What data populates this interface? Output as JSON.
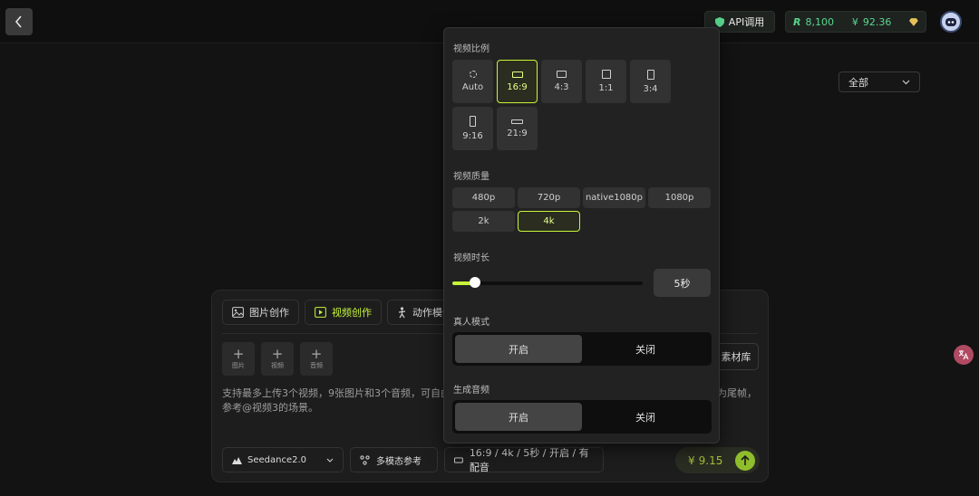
{
  "topbar": {
    "api_label": "API调用",
    "credits_value": "8,100",
    "balance_value": "92.36",
    "credit_symbol": "R",
    "currency_symbol": "¥"
  },
  "filter": {
    "selected": "全部"
  },
  "popover": {
    "ratio_title": "视频比例",
    "ratios": [
      {
        "label": "Auto",
        "selected": false
      },
      {
        "label": "16:9",
        "selected": true
      },
      {
        "label": "4:3",
        "selected": false
      },
      {
        "label": "1:1",
        "selected": false
      },
      {
        "label": "3:4",
        "selected": false
      },
      {
        "label": "9:16",
        "selected": false
      },
      {
        "label": "21:9",
        "selected": false
      }
    ],
    "quality_title": "视频质量",
    "qualities": [
      {
        "label": "480p",
        "selected": false
      },
      {
        "label": "720p",
        "selected": false
      },
      {
        "label": "native1080p",
        "selected": false
      },
      {
        "label": "1080p",
        "selected": false
      },
      {
        "label": "2k",
        "selected": false
      },
      {
        "label": "4k",
        "selected": true
      }
    ],
    "duration_title": "视频时长",
    "duration_value": "5秒",
    "duration_fraction": 0.12,
    "realperson_title": "真人模式",
    "realperson_on": "开启",
    "realperson_off": "关闭",
    "audio_title": "生成音频",
    "audio_on": "开启",
    "audio_off": "关闭"
  },
  "composer": {
    "tabs": [
      {
        "label": "图片创作",
        "icon": "image-icon"
      },
      {
        "label": "视频创作",
        "icon": "video-icon"
      },
      {
        "label": "动作模仿",
        "icon": "person-icon"
      }
    ],
    "uploads": [
      {
        "label": "图片"
      },
      {
        "label": "视频"
      },
      {
        "label": "音频"
      }
    ],
    "library_label": "素材库",
    "hint_line1": "支持最多上传3个视频，9张图片和3个音频，可自由组",
    "hint_tail": "为尾帧，",
    "hint_line2": "参考@视频3的场景。",
    "model_label": "Seedance2.0",
    "mode_label": "多模态参考",
    "params_label": "16:9 / 4k / 5秒 / 开启 / 有配音",
    "price_symbol": "¥",
    "price_value": "9.15"
  },
  "colors": {
    "accent": "#c7f53a",
    "credits": "#58d68d"
  }
}
